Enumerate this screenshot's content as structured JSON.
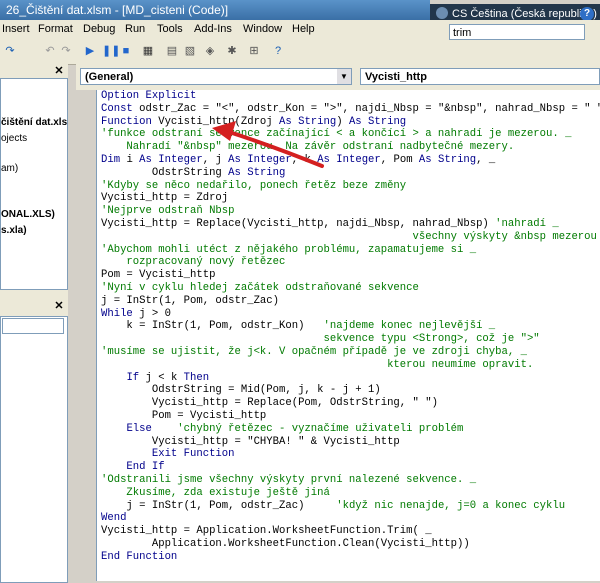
{
  "title": "26_Čištění dat.xlsm - [MD_cisteni (Code)]",
  "language_bar": {
    "label": "CS Čeština (Česká republika)",
    "help": "?"
  },
  "menu": [
    "Insert",
    "Format",
    "Debug",
    "Run",
    "Tools",
    "Add-Ins",
    "Window",
    "Help"
  ],
  "search_value": "trim",
  "project_panel": {
    "items": [
      "čištění dat.xlsm",
      "ojects",
      "am)",
      "ONAL.XLS)",
      "s.xla)"
    ]
  },
  "code_window": {
    "object_combo": "(General)",
    "procedure_combo": "Vycisti_http"
  },
  "code_lines": [
    [
      [
        "kw",
        "Option Explicit"
      ]
    ],
    [
      [
        "kw",
        "Const "
      ],
      [
        "t",
        "odstr_Zac = \"<\", odstr_Kon = \">\", najdi_Nbsp = \"&nbsp\", nahrad_Nbsp = \" \""
      ]
    ],
    [
      [
        "kw",
        "Function "
      ],
      [
        "t",
        "Vycisti_http(Zdroj "
      ],
      [
        "kw",
        "As String"
      ],
      [
        "t",
        ") "
      ],
      [
        "kw",
        "As String"
      ]
    ],
    [
      [
        "cm",
        "'funkce odstraní sekvence začínající < a končící > a nahradí je mezerou. _"
      ]
    ],
    [
      [
        "cm",
        "    Nahradí \"&nbsp\" mezerou. Na závěr odstraní nadbytečné mezery."
      ]
    ],
    [
      [
        "kw",
        "Dim "
      ],
      [
        "t",
        "i "
      ],
      [
        "kw",
        "As Integer"
      ],
      [
        "t",
        ", j "
      ],
      [
        "kw",
        "As Integer"
      ],
      [
        "t",
        ", k "
      ],
      [
        "kw",
        "As Integer"
      ],
      [
        "t",
        ", Pom "
      ],
      [
        "kw",
        "As String"
      ],
      [
        "t",
        ", _"
      ]
    ],
    [
      [
        "t",
        "        OdstrString "
      ],
      [
        "kw",
        "As String"
      ]
    ],
    [
      [
        "cm",
        "'Kdyby se něco nedařilo, ponech řetěz beze změny"
      ]
    ],
    [
      [
        "t",
        "Vycisti_http = Zdroj"
      ]
    ],
    [
      [
        "cm",
        "'Nejprve odstraň Nbsp"
      ]
    ],
    [
      [
        "t",
        "Vycisti_http = Replace(Vycisti_http, najdi_Nbsp, nahrad_Nbsp) "
      ],
      [
        "cm",
        "'nahradí _"
      ]
    ],
    [
      [
        "cm",
        "                                                 všechny výskyty &nbsp mezerou"
      ]
    ],
    [
      [
        "cm",
        "'Abychom mohli utéct z nějakého problému, zapamatujeme si _"
      ]
    ],
    [
      [
        "cm",
        "    rozpracovaný nový řetězec"
      ]
    ],
    [
      [
        "t",
        "Pom = Vycisti_http"
      ]
    ],
    [
      [
        "cm",
        "'Nyní v cyklu hledej začátek odstraňované sekvence"
      ]
    ],
    [
      [
        "t",
        "j = InStr(1, Pom, odstr_Zac)"
      ]
    ],
    [
      [
        "kw",
        "While "
      ],
      [
        "t",
        "j > 0"
      ]
    ],
    [
      [
        "t",
        "    k = InStr(1, Pom, odstr_Kon)   "
      ],
      [
        "cm",
        "'najdeme konec nejlevější _"
      ]
    ],
    [
      [
        "cm",
        "                                   sekvence typu <Strong>, což je \">\""
      ]
    ],
    [
      [
        "cm",
        "'musíme se ujistit, že j<k. V opačném případě je ve zdroji chyba, _"
      ]
    ],
    [
      [
        "cm",
        "                                             kterou neumíme opravit."
      ]
    ],
    [
      [
        "t",
        "    "
      ],
      [
        "kw",
        "If "
      ],
      [
        "t",
        "j < k "
      ],
      [
        "kw",
        "Then"
      ]
    ],
    [
      [
        "t",
        "        OdstrString = Mid(Pom, j, k - j + 1)"
      ]
    ],
    [
      [
        "t",
        "        Vycisti_http = Replace(Pom, OdstrString, \" \")"
      ]
    ],
    [
      [
        "t",
        "        Pom = Vycisti_http"
      ]
    ],
    [
      [
        "t",
        "    "
      ],
      [
        "kw",
        "Else    "
      ],
      [
        "cm",
        "'chybný řetězec - vyznačíme uživateli problém"
      ]
    ],
    [
      [
        "t",
        "        Vycisti_http = \"CHYBA! \" & Vycisti_http"
      ]
    ],
    [
      [
        "kw",
        "        Exit Function"
      ]
    ],
    [
      [
        "kw",
        "    End If"
      ]
    ],
    [
      [
        "cm",
        "'Odstranili jsme všechny výskyty první nalezené sekvence. _"
      ]
    ],
    [
      [
        "cm",
        "    Zkusíme, zda existuje ještě jiná"
      ]
    ],
    [
      [
        "t",
        "    j = InStr(1, Pom, odstr_Zac)     "
      ],
      [
        "cm",
        "'když nic nenajde, j=0 a konec cyklu"
      ]
    ],
    [
      [
        "kw",
        "Wend"
      ]
    ],
    [
      [
        "t",
        "Vycisti_http = Application.WorksheetFunction.Trim( _"
      ]
    ],
    [
      [
        "t",
        "        Application.WorksheetFunction.Clean(Vycisti_http))"
      ]
    ],
    [
      [
        "kw",
        "End Function"
      ]
    ]
  ]
}
